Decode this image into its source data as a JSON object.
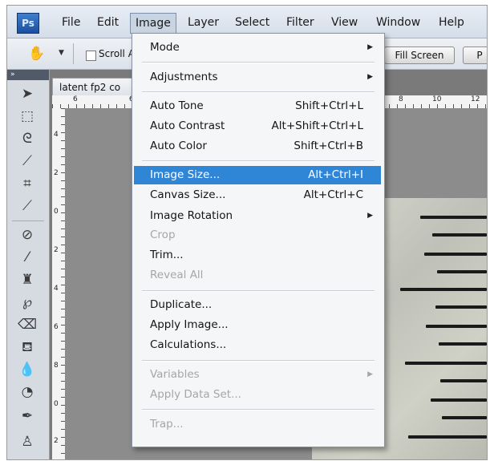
{
  "app": {
    "logo": "Ps",
    "menus": [
      "File",
      "Edit",
      "Image",
      "Layer",
      "Select",
      "Filter",
      "View",
      "Window",
      "Help"
    ],
    "open_menu": "Image"
  },
  "options_bar": {
    "scroll_label": "Scroll A",
    "fill_screen_label": "Fill Screen",
    "next_button_label": "P"
  },
  "document": {
    "tab_title": "latent fp2 co",
    "ruler_top_numbers": [
      "6",
      "6",
      "8",
      "10",
      "12"
    ],
    "ruler_left_numbers": [
      "4",
      "2",
      "0",
      "2",
      "4",
      "6",
      "8",
      "0",
      "2"
    ]
  },
  "image_menu": {
    "items": [
      {
        "label": "Mode",
        "submenu": true,
        "icon": "submenu-arrow-icon"
      },
      {
        "label": "Adjustments",
        "submenu": true,
        "icon": "submenu-arrow-icon"
      },
      {
        "label": "Auto Tone",
        "shortcut": "Shift+Ctrl+L"
      },
      {
        "label": "Auto Contrast",
        "shortcut": "Alt+Shift+Ctrl+L"
      },
      {
        "label": "Auto Color",
        "shortcut": "Shift+Ctrl+B"
      },
      {
        "label": "Image Size...",
        "shortcut": "Alt+Ctrl+I",
        "highlighted": true
      },
      {
        "label": "Canvas Size...",
        "shortcut": "Alt+Ctrl+C"
      },
      {
        "label": "Image Rotation",
        "submenu": true,
        "icon": "submenu-arrow-icon"
      },
      {
        "label": "Crop",
        "disabled": true
      },
      {
        "label": "Trim..."
      },
      {
        "label": "Reveal All",
        "disabled": true
      },
      {
        "label": "Duplicate..."
      },
      {
        "label": "Apply Image..."
      },
      {
        "label": "Calculations..."
      },
      {
        "label": "Variables",
        "submenu": true,
        "disabled": true,
        "icon": "submenu-arrow-icon"
      },
      {
        "label": "Apply Data Set...",
        "disabled": true
      },
      {
        "label": "Trap...",
        "disabled": true
      }
    ],
    "highlight_color": "#2f86d6"
  },
  "tools": [
    "move-tool-icon",
    "marquee-tool-icon",
    "lasso-tool-icon",
    "quick-selection-tool-icon",
    "crop-tool-icon",
    "eyedropper-tool-icon",
    "healing-brush-tool-icon",
    "brush-tool-icon",
    "clone-stamp-tool-icon",
    "history-brush-tool-icon",
    "eraser-tool-icon",
    "paint-bucket-tool-icon",
    "blur-tool-icon",
    "dodge-tool-icon",
    "pen-tool-icon"
  ],
  "colors": {
    "menubar": "#dbe3ee",
    "canvas_background": "#8c8c8c",
    "logo_blue": "#2a62b4"
  }
}
